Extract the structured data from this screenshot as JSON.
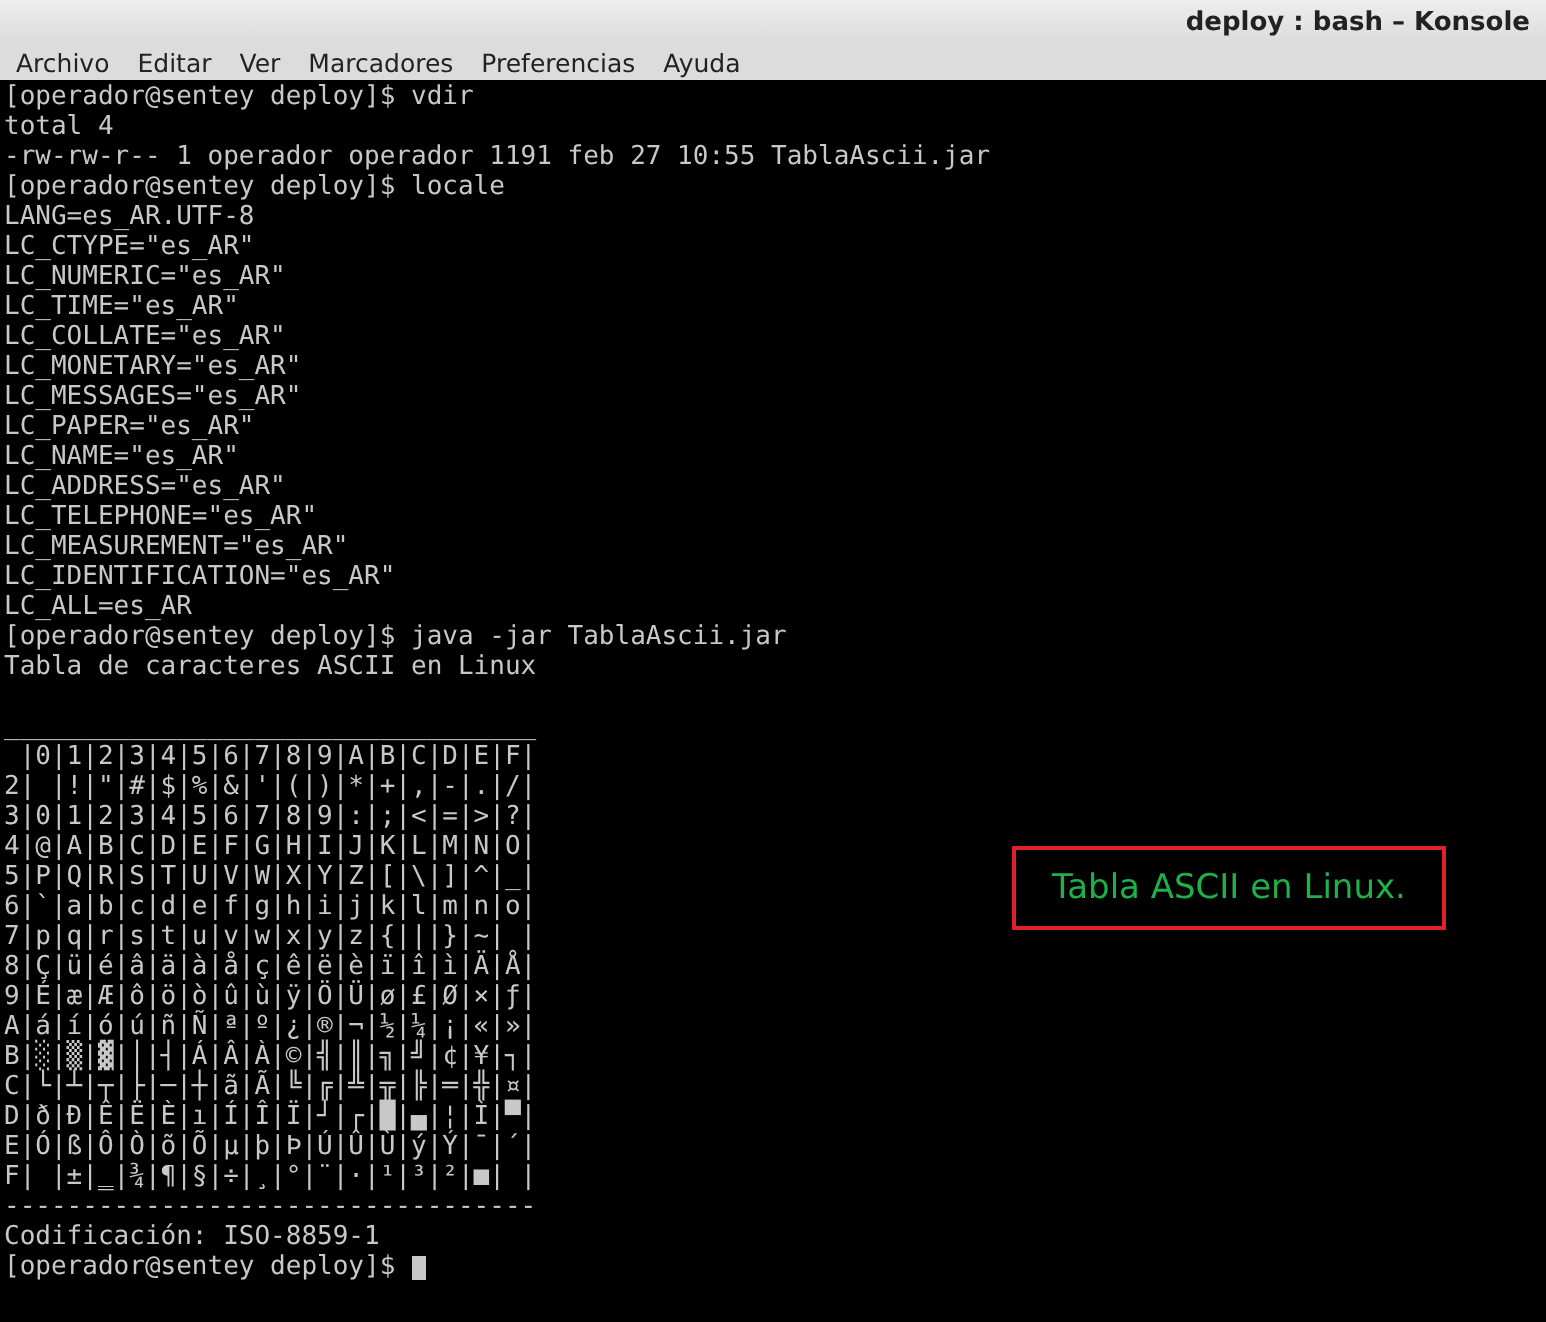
{
  "window": {
    "title": "deploy : bash – Konsole"
  },
  "menu": [
    "Archivo",
    "Editar",
    "Ver",
    "Marcadores",
    "Preferencias",
    "Ayuda"
  ],
  "terminal": {
    "cursor_visible": true,
    "lines": [
      {
        "kind": "text",
        "text": "[operador@sentey deploy]$ vdir"
      },
      {
        "kind": "text",
        "text": "total 4"
      },
      {
        "kind": "text",
        "text": "-rw-rw-r-- 1 operador operador 1191 feb 27 10:55 TablaAscii.jar"
      },
      {
        "kind": "text",
        "text": "[operador@sentey deploy]$ locale"
      },
      {
        "kind": "text",
        "text": "LANG=es_AR.UTF-8"
      },
      {
        "kind": "text",
        "text": "LC_CTYPE=\"es_AR\""
      },
      {
        "kind": "text",
        "text": "LC_NUMERIC=\"es_AR\""
      },
      {
        "kind": "text",
        "text": "LC_TIME=\"es_AR\""
      },
      {
        "kind": "text",
        "text": "LC_COLLATE=\"es_AR\""
      },
      {
        "kind": "text",
        "text": "LC_MONETARY=\"es_AR\""
      },
      {
        "kind": "text",
        "text": "LC_MESSAGES=\"es_AR\""
      },
      {
        "kind": "text",
        "text": "LC_PAPER=\"es_AR\""
      },
      {
        "kind": "text",
        "text": "LC_NAME=\"es_AR\""
      },
      {
        "kind": "text",
        "text": "LC_ADDRESS=\"es_AR\""
      },
      {
        "kind": "text",
        "text": "LC_TELEPHONE=\"es_AR\""
      },
      {
        "kind": "text",
        "text": "LC_MEASUREMENT=\"es_AR\""
      },
      {
        "kind": "text",
        "text": "LC_IDENTIFICATION=\"es_AR\""
      },
      {
        "kind": "text",
        "text": "LC_ALL=es_AR"
      },
      {
        "kind": "text",
        "text": "[operador@sentey deploy]$ java -jar TablaAscii.jar"
      },
      {
        "kind": "text",
        "text": "Tabla de caracteres ASCII en Linux"
      },
      {
        "kind": "gap"
      },
      {
        "kind": "text",
        "text": "__________________________________"
      },
      {
        "kind": "text",
        "text": " |0|1|2|3|4|5|6|7|8|9|A|B|C|D|E|F|"
      },
      {
        "kind": "text",
        "text": "2| |!|\"|#|$|%|&|'|(|)|*|+|,|-|.|/|"
      },
      {
        "kind": "text",
        "text": "3|0|1|2|3|4|5|6|7|8|9|:|;|<|=|>|?|"
      },
      {
        "kind": "text",
        "text": "4|@|A|B|C|D|E|F|G|H|I|J|K|L|M|N|O|"
      },
      {
        "kind": "text",
        "text": "5|P|Q|R|S|T|U|V|W|X|Y|Z|[|\\|]|^|_|"
      },
      {
        "kind": "text",
        "text": "6|`|a|b|c|d|e|f|g|h|i|j|k|l|m|n|o|"
      },
      {
        "kind": "text",
        "text": "7|p|q|r|s|t|u|v|w|x|y|z|{|||}|~| |"
      },
      {
        "kind": "text",
        "text": "8|Ç|ü|é|â|ä|à|å|ç|ê|ë|è|ï|î|ì|Ä|Å|"
      },
      {
        "kind": "text",
        "text": "9|É|æ|Æ|ô|ö|ò|û|ù|ÿ|Ö|Ü|ø|£|Ø|×|ƒ|"
      },
      {
        "kind": "text",
        "text": "A|á|í|ó|ú|ñ|Ñ|ª|º|¿|®|¬|½|¼|¡|«|»|"
      },
      {
        "kind": "text",
        "text": "B|░|▒|▓|│|┤|Á|Â|À|©|╣|║|╗|╝|¢|¥|┐|"
      },
      {
        "kind": "text",
        "text": "C|└|┴|┬|├|─|┼|ã|Ã|╚|╔|╩|╦|╠|═|╬|¤|"
      },
      {
        "kind": "text",
        "text": "D|ð|Ð|Ê|Ë|È|ı|Í|Î|Ï|┘|┌|█|▄|¦|Ì|▀|"
      },
      {
        "kind": "text",
        "text": "E|Ó|ß|Ô|Ò|õ|Õ|µ|þ|Þ|Ú|Û|Ù|ý|Ý|¯|´|"
      },
      {
        "kind": "text",
        "text": "F| |±|‗|¾|¶|§|÷|¸|°|¨|·|¹|³|²|■| |"
      },
      {
        "kind": "text",
        "text": "----------------------------------"
      },
      {
        "kind": "text",
        "text": "Codificación: ISO-8859-1"
      },
      {
        "kind": "prompt",
        "text": "[operador@sentey deploy]$"
      }
    ]
  },
  "annotation": {
    "text": "Tabla ASCII en Linux."
  }
}
